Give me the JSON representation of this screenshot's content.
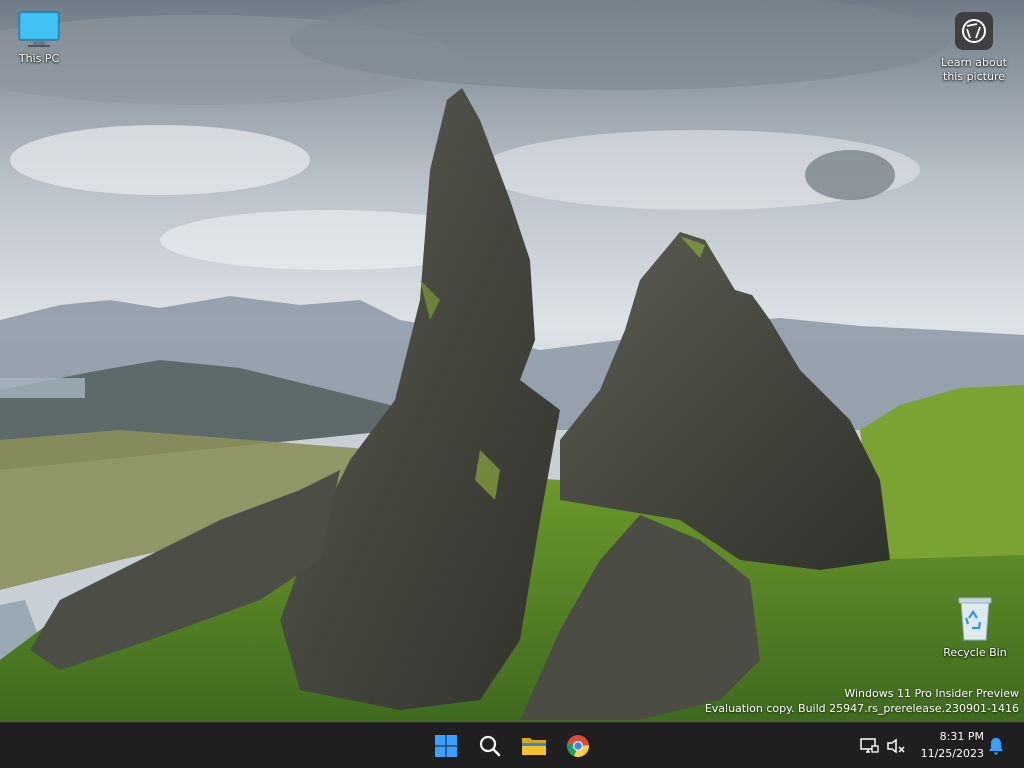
{
  "desktop": {
    "icons": [
      {
        "label": "This PC",
        "icon": "monitor-icon"
      },
      {
        "label": "Learn about this picture",
        "icon": "camera-aperture-icon"
      },
      {
        "label": "Recycle Bin",
        "icon": "recycle-bin-icon"
      }
    ],
    "watermark": {
      "line1": "Windows 11 Pro Insider Preview",
      "line2": "Evaluation copy. Build 25947.rs_prerelease.230901-1416"
    }
  },
  "taskbar": {
    "apps": [
      {
        "name": "Start",
        "icon": "windows-start-icon",
        "color": "#3aa0ff"
      },
      {
        "name": "Search",
        "icon": "search-icon",
        "color": "#ffffff"
      },
      {
        "name": "File Explorer",
        "icon": "folder-icon",
        "color": "#f2c230"
      },
      {
        "name": "Google Chrome",
        "icon": "chrome-icon",
        "color": "#dd4b39"
      }
    ],
    "tray": {
      "network_icon": "network-monitor-icon",
      "volume_icon": "speaker-muted-icon",
      "time": "8:31 PM",
      "date": "11/25/2023",
      "notification_icon": "bell-icon"
    }
  },
  "colors": {
    "taskbar_bg": "#1f1f1f",
    "accent_blue": "#3aa0ff",
    "grass_green": "#5a8a2a"
  }
}
